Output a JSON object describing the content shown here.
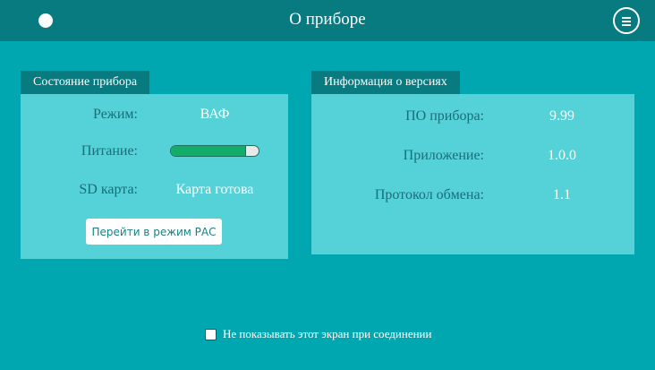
{
  "header": {
    "title": "О приборе",
    "status_icon": "status-dot-icon",
    "menu_icon": "menu-icon"
  },
  "device_status": {
    "title": "Состояние прибора",
    "rows": [
      {
        "label": "Режим:",
        "value": "ВАФ"
      },
      {
        "label": "Питание:",
        "value": ""
      },
      {
        "label": "SD карта:",
        "value": "Карта готова"
      }
    ],
    "power_level_percent": 86,
    "rac_button_label": "Перейти в режим РАС"
  },
  "versions": {
    "title": "Информация о версиях",
    "rows": [
      {
        "label": "ПО прибора:",
        "value": "9.99"
      },
      {
        "label": "Приложение:",
        "value": "1.0.0"
      },
      {
        "label": "Протокол обмена:",
        "value": "1.1"
      }
    ]
  },
  "footer": {
    "checkbox_label": "Не показывать этот экран при соединении",
    "checked": false
  },
  "colors": {
    "background": "#00a7b1",
    "header": "#087b80",
    "panel": "#55d1d8",
    "power_fill": "#13ad6a"
  }
}
